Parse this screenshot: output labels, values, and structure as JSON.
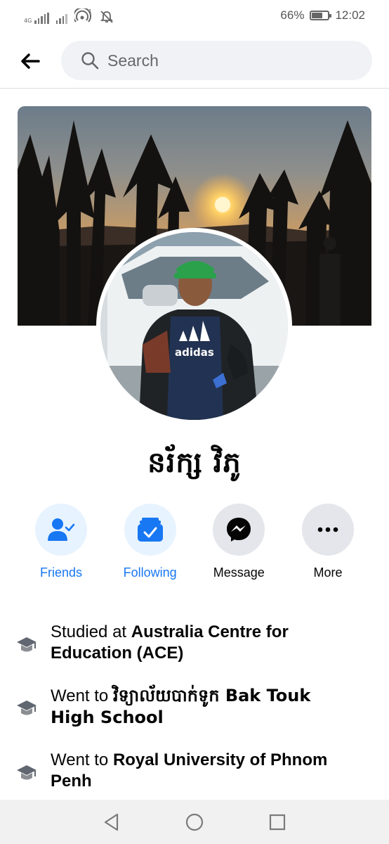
{
  "status_bar": {
    "network_label_top": "4G",
    "network_label_bottom": "4G",
    "notification_count": "1",
    "battery_percent": "66%",
    "battery_level": 0.66,
    "time": "12:02"
  },
  "search": {
    "placeholder": "Search"
  },
  "profile": {
    "name": "នរ័ក្ស វិភូ"
  },
  "actions": [
    {
      "label": "Friends",
      "icon": "friends-icon",
      "color": "#1877f2"
    },
    {
      "label": "Following",
      "icon": "following-icon",
      "color": "#1877f2"
    },
    {
      "label": "Message",
      "icon": "messenger-icon",
      "color": "#050505"
    },
    {
      "label": "More",
      "icon": "more-icon",
      "color": "#050505"
    }
  ],
  "intro": [
    {
      "prefix": "Studied at ",
      "place": "Australia Centre for Education (ACE)",
      "icon": "education-icon"
    },
    {
      "prefix": "Went to ",
      "place": "វិទ្យាល័យបាក់ទូក Bak Touk High School",
      "icon": "education-icon"
    },
    {
      "prefix": "Went to ",
      "place": "Royal University of Phnom Penh",
      "icon": "education-icon"
    }
  ],
  "colors": {
    "accent": "#1877f2",
    "accent_light": "#e7f3ff",
    "grey_button": "#e4e6eb"
  }
}
